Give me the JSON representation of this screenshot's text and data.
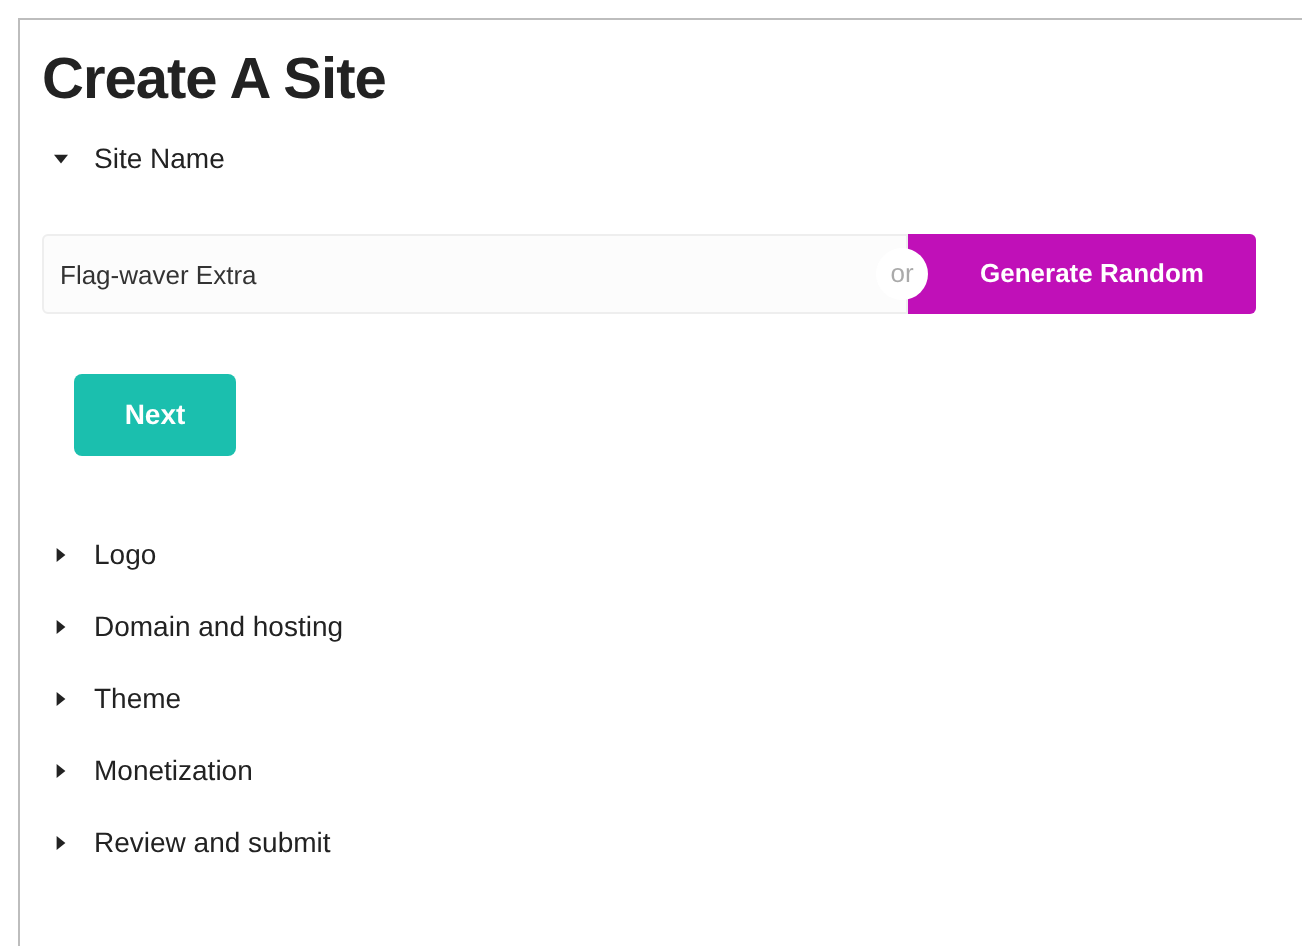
{
  "title": "Create A Site",
  "sections": [
    {
      "label": "Site Name",
      "expanded": true
    },
    {
      "label": "Logo",
      "expanded": false
    },
    {
      "label": "Domain and hosting",
      "expanded": false
    },
    {
      "label": "Theme",
      "expanded": false
    },
    {
      "label": "Monetization",
      "expanded": false
    },
    {
      "label": "Review and submit",
      "expanded": false
    }
  ],
  "site_name": {
    "value": "Flag-waver Extra",
    "separator": "or",
    "generate_button": "Generate Random",
    "next_button": "Next"
  }
}
